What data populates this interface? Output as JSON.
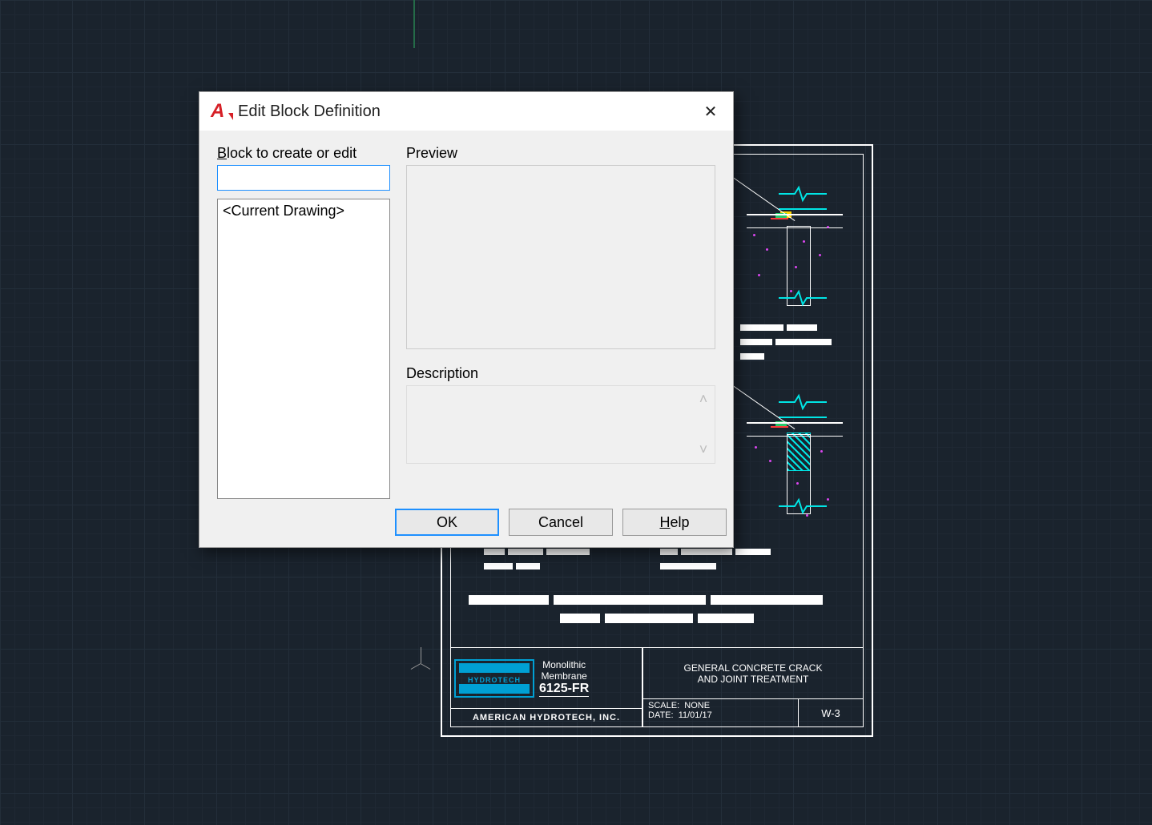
{
  "dialog": {
    "title": "Edit Block Definition",
    "block_label_prefix": "B",
    "block_label_rest": "lock to create or edit",
    "block_name_value": "",
    "list_items": [
      "<Current Drawing>"
    ],
    "preview_label": "Preview",
    "description_label": "Description",
    "description_value": "",
    "ok_label": "OK",
    "cancel_label": "Cancel",
    "help_prefix": "H",
    "help_rest": "elp",
    "close_glyph": "✕"
  },
  "drawing": {
    "logo_text": "HYDROTECH",
    "product_line1": "Monolithic",
    "product_line2": "Membrane",
    "product_code": "6125-FR",
    "company": "AMERICAN HYDROTECH, INC.",
    "title_line1": "GENERAL CONCRETE CRACK",
    "title_line2": "AND JOINT TREATMENT",
    "scale_label": "SCALE:",
    "scale_value": "NONE",
    "date_label": "DATE:",
    "date_value": "11/01/17",
    "sheet_no": "W-3"
  }
}
